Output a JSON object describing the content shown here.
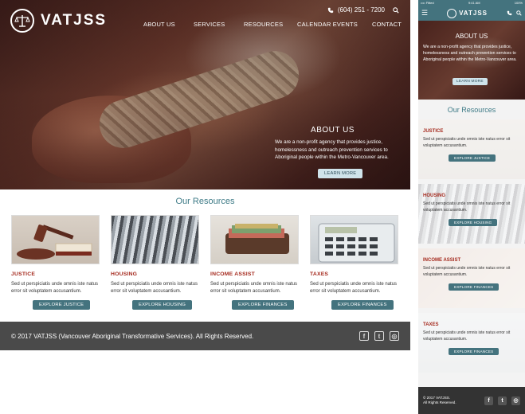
{
  "brand": {
    "name": "VATJSS"
  },
  "header": {
    "phone": "(604) 251 - 7200",
    "nav": [
      "ABOUT US",
      "SERVICES",
      "RESOURCES",
      "CALENDAR EVENTS",
      "CONTACT"
    ]
  },
  "hero": {
    "title": "ABOUT US",
    "text": "We are a non-profit agency that provides justice, homelessness and outreach prevention services to Aboriginal people within the Metro-Vancouver area.",
    "button": "LEARN MORE"
  },
  "resources": {
    "title": "Our Resources",
    "cards": [
      {
        "title": "JUSTICE",
        "text": "Sed ut perspiciatis unde omnis iste natus error sit voluptatem accusantium.",
        "button": "EXPLORE JUSTICE"
      },
      {
        "title": "HOUSING",
        "text": "Sed ut perspiciatis unde omnis iste natus error sit voluptatem accusantium.",
        "button": "EXPLORE HOUSING"
      },
      {
        "title": "INCOME ASSIST",
        "text": "Sed ut perspiciatis unde omnis iste natus error sit voluptatem accusantium.",
        "button": "EXPLORE FINANCES"
      },
      {
        "title": "TAXES",
        "text": "Sed ut perspiciatis unde omnis iste natus error sit voluptatem accusantium.",
        "button": "EXPLORE FINANCES"
      }
    ]
  },
  "footer": {
    "copyright": "© 2017 VATJSS (Vancouver Aboriginal Transformative Services). All Rights Reserved.",
    "social": [
      "facebook-icon",
      "twitter-icon",
      "instagram-icon"
    ]
  },
  "mobile": {
    "status": {
      "carrier": "•••• Fitted",
      "time": "9:41 AM",
      "battery": "100%"
    },
    "footer_line1": "© 2017 VATJSS.",
    "footer_line2": "All Rights Reserved."
  },
  "colors": {
    "accent": "#44737e",
    "heading": "#3d7a86",
    "card_title": "#a52a1e",
    "footer": "#4a4a4a"
  }
}
